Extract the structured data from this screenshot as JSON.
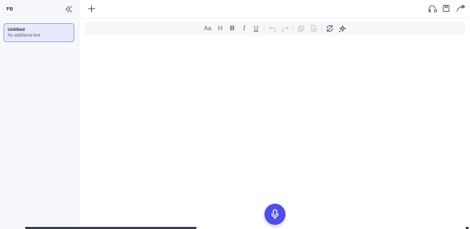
{
  "sidebar": {
    "avatar_initials": "FB",
    "notes": [
      {
        "title": "Untitled",
        "subtitle": "No additional text",
        "selected": true
      }
    ]
  },
  "header": {
    "new_icon": "plus-icon",
    "actions": [
      "headphones-icon",
      "bookmark-icon",
      "share-arrow-icon"
    ]
  },
  "toolbar": {
    "font_size_label": "Aa",
    "heading_label": "H",
    "bold_label": "B",
    "italic_label": "I",
    "underline_label": "U",
    "icons": [
      "undo-icon",
      "redo-icon",
      "copy-icon",
      "export-file-icon",
      "refresh-icon",
      "ai-sparkle-icon"
    ]
  },
  "mic": {
    "icon": "microphone-icon"
  },
  "colors": {
    "accent": "#4f4fe6",
    "card_bg": "#e9e9fb",
    "card_border": "#9a9ce8",
    "sidebar_bg": "#f7f8fb",
    "toolbar_bg": "#f6f7f9"
  }
}
